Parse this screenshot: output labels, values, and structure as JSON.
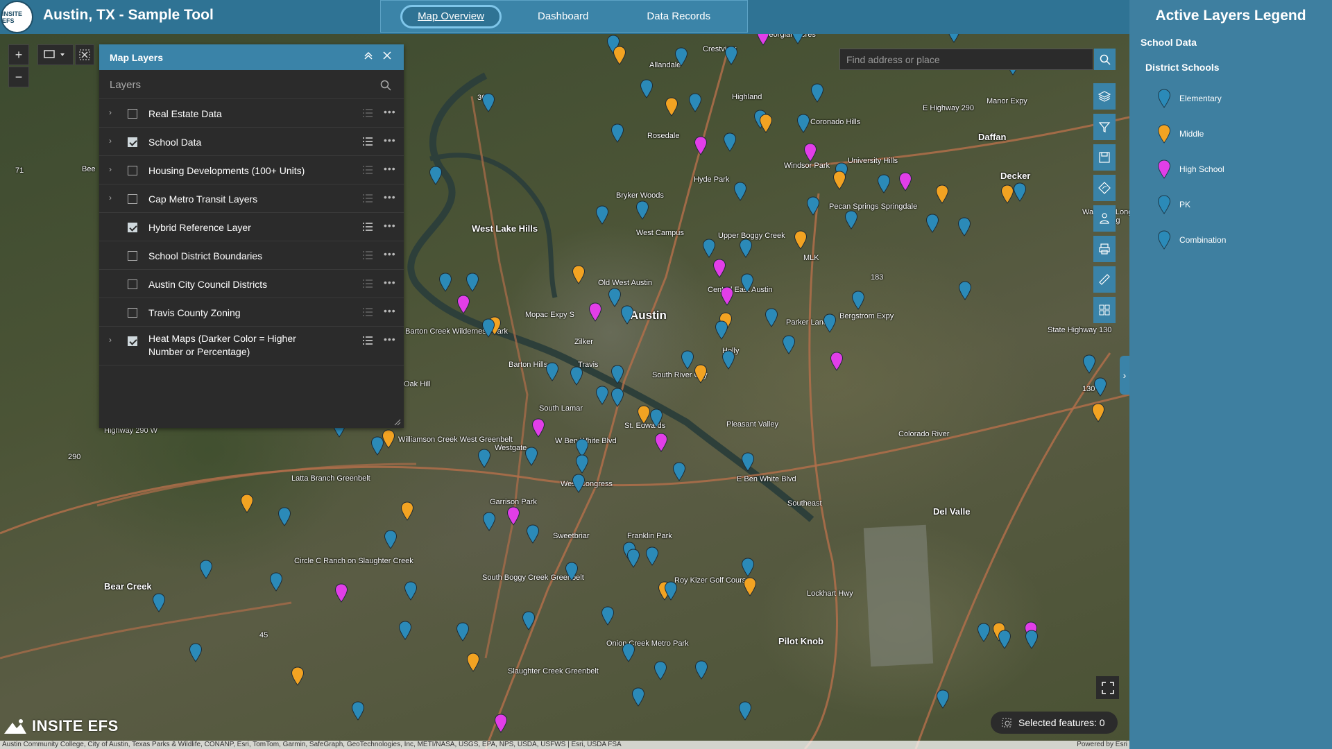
{
  "header": {
    "logo_text": "INSITE EFS",
    "title": "Austin, TX - Sample Tool",
    "tabs": [
      {
        "label": "Map Overview",
        "active": true
      },
      {
        "label": "Dashboard",
        "active": false
      },
      {
        "label": "Data Records",
        "active": false
      }
    ]
  },
  "layers_panel": {
    "title": "Map Layers",
    "search_placeholder": "Layers",
    "layers": [
      {
        "label": "Real Estate Data",
        "checked": false,
        "expandable": true
      },
      {
        "label": "School Data",
        "checked": true,
        "expandable": true
      },
      {
        "label": "Housing Developments (100+ Units)",
        "checked": false,
        "expandable": true
      },
      {
        "label": "Cap Metro Transit Layers",
        "checked": false,
        "expandable": true
      },
      {
        "label": "Hybrid Reference Layer",
        "checked": true,
        "expandable": false
      },
      {
        "label": "School District Boundaries",
        "checked": false,
        "expandable": false
      },
      {
        "label": "Austin City Council Districts",
        "checked": false,
        "expandable": false
      },
      {
        "label": "Travis County Zoning",
        "checked": false,
        "expandable": false
      },
      {
        "label": "Heat Maps (Darker Color = Higher Number or Percentage)",
        "checked": true,
        "expandable": true
      }
    ]
  },
  "map": {
    "search_placeholder": "Find address or place",
    "selected_features": "Selected features: 0",
    "brand": "INSITE EFS",
    "attribution": "Austin Community College, City of Austin, Texas Parks & Wildlife, CONANP, Esri, TomTom, Garmin, SafeGraph, GeoTechnologies, Inc, METI/NASA, USGS, EPA, NPS, USDA, USFWS | Esri, USDA FSA",
    "powered_by": "Powered by Esri",
    "places": [
      {
        "name": "Austin",
        "size": "big"
      },
      {
        "name": "West Lake Hills",
        "size": "med"
      },
      {
        "name": "Bear Creek",
        "size": "med"
      },
      {
        "name": "Del Valle",
        "size": "med"
      },
      {
        "name": "Pilot Knob",
        "size": "med"
      },
      {
        "name": "Daffan",
        "size": "med"
      },
      {
        "name": "Decker",
        "size": "med"
      },
      {
        "name": "Rosedale",
        "size": "small"
      },
      {
        "name": "Hyde Park",
        "size": "small"
      },
      {
        "name": "Crestview",
        "size": "small"
      },
      {
        "name": "Georgian Acres",
        "size": "small"
      },
      {
        "name": "Highland",
        "size": "small"
      },
      {
        "name": "Pecan Springs Springdale",
        "size": "small"
      },
      {
        "name": "Barton Creek Wilderness Park",
        "size": "small"
      },
      {
        "name": "Barton Hills",
        "size": "small"
      },
      {
        "name": "Zilker",
        "size": "small"
      },
      {
        "name": "South River City",
        "size": "small"
      },
      {
        "name": "St. Edwards",
        "size": "small"
      },
      {
        "name": "Pleasant Valley",
        "size": "small"
      },
      {
        "name": "West Oak Hill",
        "size": "small"
      },
      {
        "name": "Williamson Creek West Greenbelt",
        "size": "small"
      },
      {
        "name": "Latta Branch Greenbelt",
        "size": "small"
      },
      {
        "name": "Westgate",
        "size": "small"
      },
      {
        "name": "West Congress",
        "size": "small"
      },
      {
        "name": "South Lamar",
        "size": "small"
      },
      {
        "name": "Southeast",
        "size": "small"
      },
      {
        "name": "Circle C Ranch on Slaughter Creek",
        "size": "small"
      },
      {
        "name": "South Boggy Creek Greenbelt",
        "size": "small"
      },
      {
        "name": "Roy Kizer Golf Course",
        "size": "small"
      },
      {
        "name": "Onion Creek Metro Park",
        "size": "small"
      },
      {
        "name": "Slaughter Creek Greenbelt",
        "size": "small"
      },
      {
        "name": "Upper Boggy Creek",
        "size": "small"
      },
      {
        "name": "West Campus",
        "size": "small"
      },
      {
        "name": "MLK",
        "size": "small"
      },
      {
        "name": "Holly",
        "size": "small"
      },
      {
        "name": "Manor Expy",
        "size": "small"
      },
      {
        "name": "E Highway 290",
        "size": "small"
      },
      {
        "name": "Highway 290 W",
        "size": "small"
      },
      {
        "name": "E Ben White Blvd",
        "size": "small"
      },
      {
        "name": "W Ben White Blvd",
        "size": "small"
      },
      {
        "name": "Mopac Expy S",
        "size": "small"
      },
      {
        "name": "Bergstrom Expy",
        "size": "small"
      },
      {
        "name": "State Highway 130",
        "size": "small"
      },
      {
        "name": "Lockhart Hwy",
        "size": "small"
      },
      {
        "name": "Colorado River",
        "size": "small"
      },
      {
        "name": "Travis",
        "size": "small"
      },
      {
        "name": "Old West Austin",
        "size": "small"
      },
      {
        "name": "Bryker Woods",
        "size": "small"
      },
      {
        "name": "Windsor Park",
        "size": "small"
      },
      {
        "name": "University Hills",
        "size": "small"
      },
      {
        "name": "Coronado Hills",
        "size": "small"
      },
      {
        "name": "Franklin Park",
        "size": "small"
      },
      {
        "name": "Sweetbriar",
        "size": "small"
      },
      {
        "name": "Garrison Park",
        "size": "small"
      },
      {
        "name": "Walter E. Long Park",
        "size": "small"
      },
      {
        "name": "Central East Austin",
        "size": "small"
      },
      {
        "name": "Parker Lane",
        "size": "small"
      },
      {
        "name": "Allandale",
        "size": "small"
      },
      {
        "name": "Oak Hill",
        "size": "small"
      },
      {
        "name": "Bee",
        "size": "small"
      },
      {
        "name": "Long",
        "size": "small"
      },
      {
        "name": "360",
        "size": "small"
      },
      {
        "name": "71",
        "size": "small"
      },
      {
        "name": "183",
        "size": "small"
      },
      {
        "name": "290",
        "size": "small"
      },
      {
        "name": "45",
        "size": "small"
      },
      {
        "name": "130",
        "size": "small"
      }
    ],
    "pin_colors": {
      "Elementary": "#2b8ab8",
      "Middle": "#f2a322",
      "High School": "#e23ee8",
      "PK": "#2b8ab8",
      "Combination": "#2b8ab8"
    }
  },
  "legend": {
    "title": "Active Layers Legend",
    "group": "School Data",
    "subgroup": "District Schools",
    "items": [
      {
        "label": "Elementary",
        "color": "#2b8ab8"
      },
      {
        "label": "Middle",
        "color": "#f2a322"
      },
      {
        "label": "High School",
        "color": "#e23ee8"
      },
      {
        "label": "PK",
        "color": "#2b8ab8"
      },
      {
        "label": "Combination",
        "color": "#2b8ab8"
      }
    ]
  }
}
